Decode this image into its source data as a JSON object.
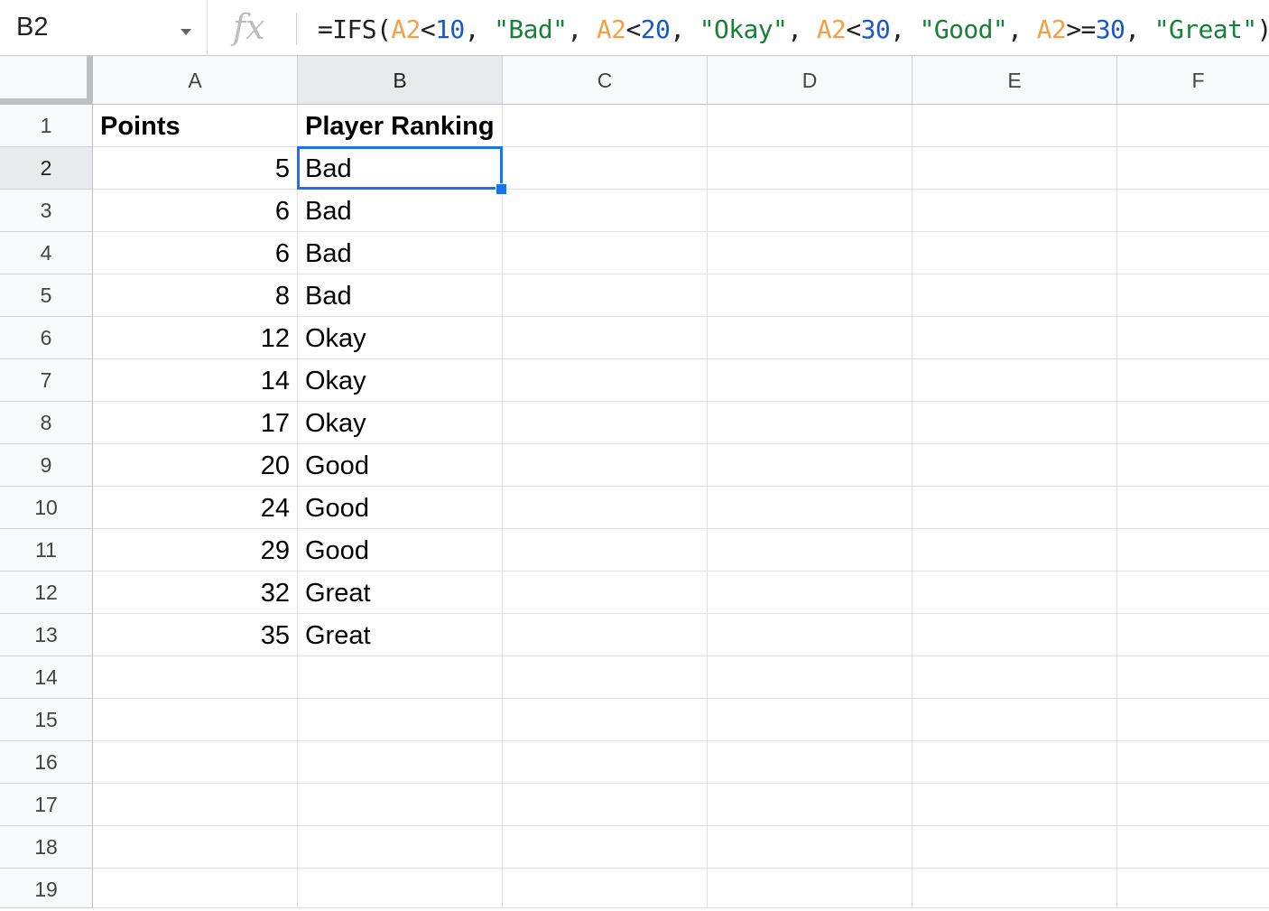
{
  "formula_bar": {
    "name_box": "B2",
    "fx_label": "fx",
    "formula_tokens": [
      {
        "t": "=IFS(",
        "k": "plain"
      },
      {
        "t": "A2",
        "k": "ref"
      },
      {
        "t": "<",
        "k": "plain"
      },
      {
        "t": "10",
        "k": "num"
      },
      {
        "t": ", ",
        "k": "plain"
      },
      {
        "t": "\"Bad\"",
        "k": "str"
      },
      {
        "t": ", ",
        "k": "plain"
      },
      {
        "t": "A2",
        "k": "ref"
      },
      {
        "t": "<",
        "k": "plain"
      },
      {
        "t": "20",
        "k": "num"
      },
      {
        "t": ", ",
        "k": "plain"
      },
      {
        "t": "\"Okay\"",
        "k": "str"
      },
      {
        "t": ", ",
        "k": "plain"
      },
      {
        "t": "A2",
        "k": "ref"
      },
      {
        "t": "<",
        "k": "plain"
      },
      {
        "t": "30",
        "k": "num"
      },
      {
        "t": ", ",
        "k": "plain"
      },
      {
        "t": "\"Good\"",
        "k": "str"
      },
      {
        "t": ", ",
        "k": "plain"
      },
      {
        "t": "A2",
        "k": "ref"
      },
      {
        "t": ">=",
        "k": "plain"
      },
      {
        "t": "30",
        "k": "num"
      },
      {
        "t": ", ",
        "k": "plain"
      },
      {
        "t": "\"Great\"",
        "k": "str"
      },
      {
        "t": ")",
        "k": "plain"
      }
    ]
  },
  "grid": {
    "selected_cell": "B2",
    "columns": [
      "A",
      "B",
      "C",
      "D",
      "E",
      "F"
    ],
    "row_numbers": [
      "1",
      "2",
      "3",
      "4",
      "5",
      "6",
      "7",
      "8",
      "9",
      "10",
      "11",
      "12",
      "13",
      "14",
      "15",
      "16",
      "17",
      "18",
      "19"
    ],
    "rows": [
      [
        "Points",
        "Player Ranking"
      ],
      [
        "5",
        "Bad"
      ],
      [
        "6",
        "Bad"
      ],
      [
        "6",
        "Bad"
      ],
      [
        "8",
        "Bad"
      ],
      [
        "12",
        "Okay"
      ],
      [
        "14",
        "Okay"
      ],
      [
        "17",
        "Okay"
      ],
      [
        "20",
        "Good"
      ],
      [
        "24",
        "Good"
      ],
      [
        "29",
        "Good"
      ],
      [
        "32",
        "Great"
      ],
      [
        "35",
        "Great"
      ]
    ]
  }
}
